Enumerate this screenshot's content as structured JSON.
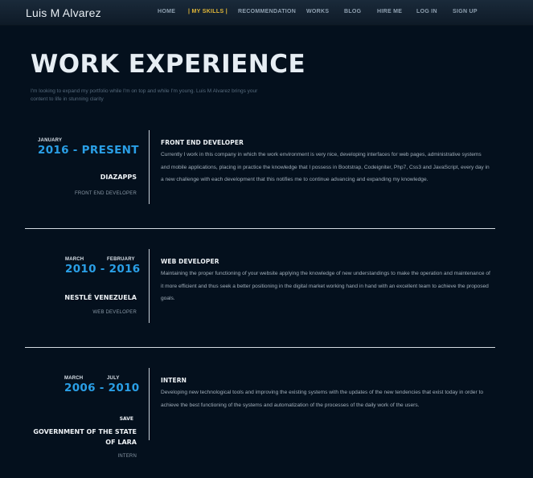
{
  "navbar": {
    "brand": "Luis M Alvarez",
    "items": [
      {
        "label": "HOME"
      },
      {
        "label": "MY SKILLS"
      },
      {
        "label": "RECOMMENDATION"
      },
      {
        "label": "WORKS"
      },
      {
        "label": "BLOG"
      },
      {
        "label": "HIRE ME"
      },
      {
        "label": "LOG IN"
      },
      {
        "label": "SIGN UP"
      }
    ],
    "separator": "|"
  },
  "page": {
    "title": "WORK EXPERIENCE",
    "intro": "I'm looking to expand my portfolio while I'm on top and while I'm young. Luis M Alvarez brings your content to life in stunning clarity"
  },
  "experience": [
    {
      "start_month": "JANUARY",
      "end_month": "",
      "years": "2016 - PRESENT",
      "company": "DIAZAPPS",
      "role_small": "FRONT END DEVELOPER",
      "job_title": "FRONT END DEVELOPER",
      "description": "Currently I work in this company in which the work environment is very nice, developing interfaces for web pages, administrative systems and mobile applications, placing in practice the knowledge that I possess in Bootstrap, Codeigniter, Php7, Css3 and JavaScript, every day in a new challenge with each development that this notifies me to continue advancing and expanding my knowledge."
    },
    {
      "start_month": "MARCH",
      "end_month": "FEBRUARY",
      "years": "2010 - 2016",
      "company": "NESTLÉ VENEZUELA",
      "role_small": "WEB DEVELOPER",
      "job_title": "WEB DEVELOPER",
      "description": "Maintaining the proper functioning of your website applying the knowledge of new understandings to make the operation and maintenance of it more efficient and thus seek a better positioning in the digital market working hand in hand with an excellent team to achieve the proposed goals."
    },
    {
      "start_month": "MARCH",
      "end_month": "JULY",
      "years": "2006 - 2010",
      "save_label": "SAVE",
      "company_line1": "GOVERNMENT OF THE STATE",
      "company_line2": "OF LARA",
      "role_small": "INTERN",
      "job_title": "INTERN",
      "description": "Developing new technological tools and improving the existing systems with the updates of the new tendencies that exist today in order to achieve the best functioning of the systems and automatization of the processes of the daily work of the users."
    }
  ]
}
